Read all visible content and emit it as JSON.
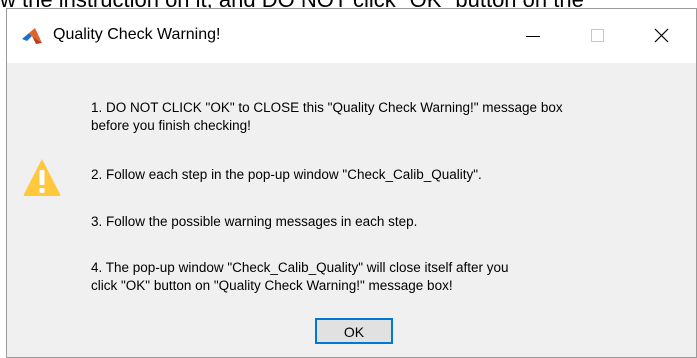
{
  "background": {
    "partial_text": "w the instruction on it, and DO NOT click \"OK\" button on the"
  },
  "dialog": {
    "title": "Quality Check Warning!",
    "icons": {
      "app": "matlab-logo-icon",
      "warning": "warning-triangle-icon"
    },
    "window_controls": {
      "minimize_icon": "minimize-icon",
      "maximize_icon": "maximize-icon",
      "close_icon": "close-icon"
    },
    "messages": [
      {
        "line1": "1. DO NOT CLICK \"OK\" to CLOSE this \"Quality Check Warning!\" message box",
        "line2": "before you finish checking!"
      },
      {
        "line1": "2. Follow each step in the pop-up window \"Check_Calib_Quality\"."
      },
      {
        "line1": "3. Follow the possible warning messages in each step."
      },
      {
        "line1": "4. The pop-up window \"Check_Calib_Quality\" will close itself after you",
        "line2": "click \"OK\" button on \"Quality Check Warning!\" message box!"
      }
    ],
    "ok_label": "OK"
  },
  "colors": {
    "accent": "#0078d7",
    "warning": "#ffc83d",
    "dialog_bg": "#f0f0f0"
  }
}
